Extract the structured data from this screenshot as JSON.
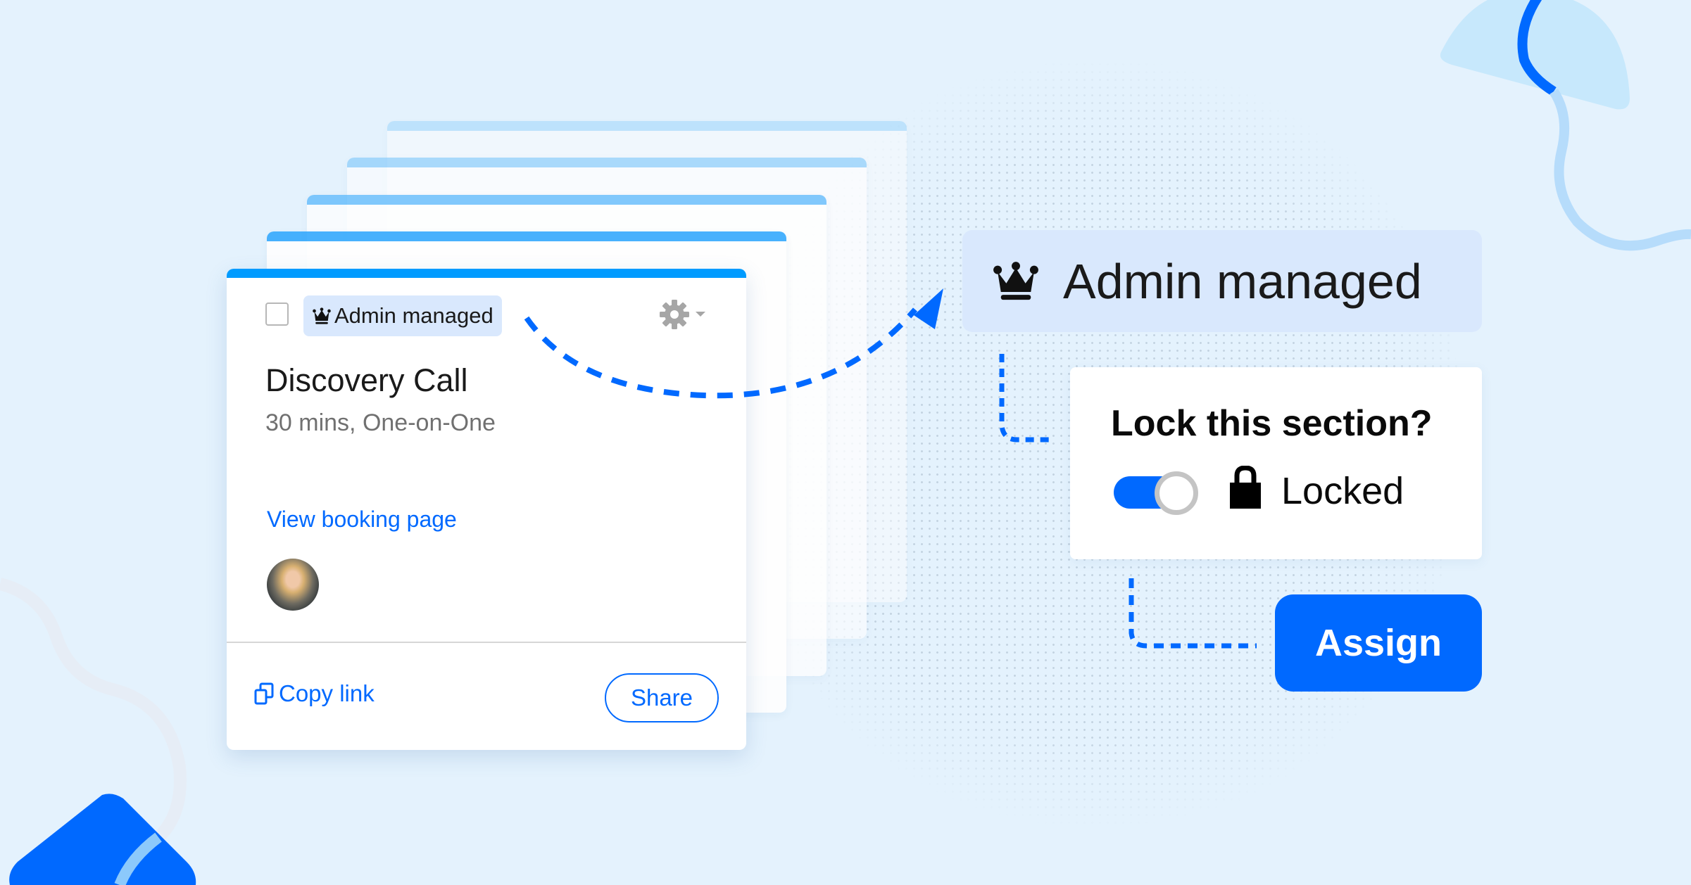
{
  "colors": {
    "background": "#e4f2fd",
    "accent": "#0069ff",
    "card_bar": "#009bff",
    "pill_bg": "#d9e8fd"
  },
  "event_card": {
    "badge_icon": "crown-icon",
    "badge_label": "Admin managed",
    "settings_icon": "gear-icon",
    "title": "Discovery Call",
    "subtitle": "30 mins, One-on-One",
    "booking_link": "View booking page",
    "copy_icon": "copy-icon",
    "copy_label": "Copy link",
    "share_label": "Share",
    "selected": false
  },
  "callout": {
    "badge_icon": "crown-icon",
    "badge_label": "Admin managed"
  },
  "lock_panel": {
    "question": "Lock this section?",
    "toggle_on": true,
    "lock_icon": "lock-icon",
    "status_label": "Locked"
  },
  "assign_button": {
    "label": "Assign"
  }
}
